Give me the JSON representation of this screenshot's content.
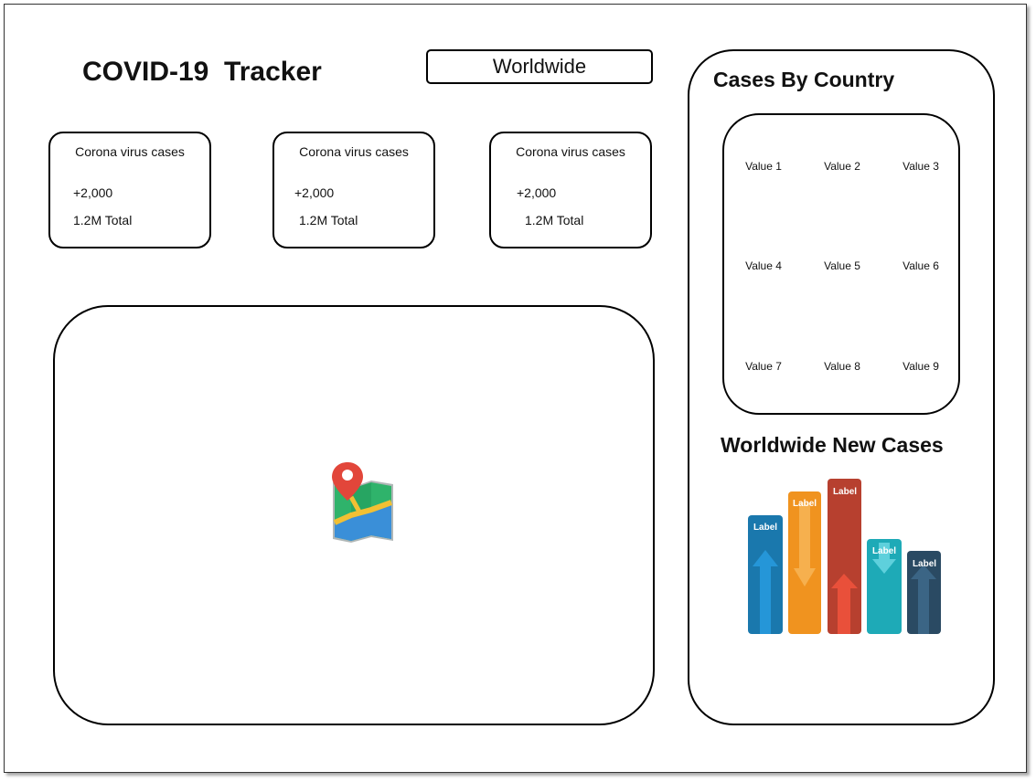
{
  "header": {
    "title": "COVID-19  Tracker",
    "region_select": "Worldwide"
  },
  "stat_cards": [
    {
      "label": "Corona virus cases",
      "new_cases": "+2,000",
      "total": "1.2M Total"
    },
    {
      "label": "Corona virus cases",
      "new_cases": "+2,000",
      "total": "1.2M Total"
    },
    {
      "label": "Corona virus cases",
      "new_cases": "+2,000",
      "total": "1.2M Total"
    }
  ],
  "map": {
    "icon": "map-icon"
  },
  "sidebar": {
    "countries_title": "Cases By Country",
    "country_values": [
      "Value 1",
      "Value 2",
      "Value 3",
      "Value 4",
      "Value 5",
      "Value 6",
      "Value 7",
      "Value 8",
      "Value 9"
    ],
    "graph_title": "Worldwide New Cases",
    "graph": {
      "bar_label": "Label",
      "colors": [
        "#1a78ad",
        "#f0931f",
        "#b7402f",
        "#1eaab7",
        "#2a4a63"
      ]
    }
  }
}
